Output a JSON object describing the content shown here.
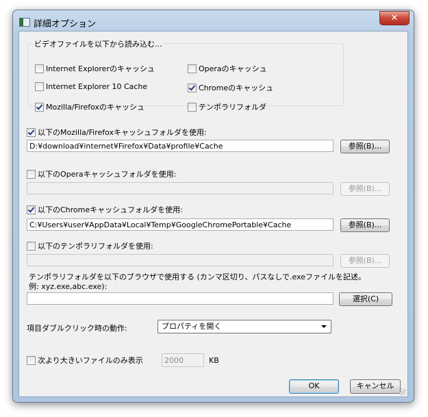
{
  "window": {
    "title": "詳細オプション",
    "close_label": "✕"
  },
  "video_group": {
    "legend": "ビデオファイルを以下から読み込む...",
    "options": [
      {
        "label": "Internet Explorerのキャッシュ",
        "checked": false
      },
      {
        "label": "Operaのキャッシュ",
        "checked": false
      },
      {
        "label": "Internet Explorer 10 Cache",
        "checked": false
      },
      {
        "label": "Chromeのキャッシュ",
        "checked": true
      },
      {
        "label": "Mozilla/Firefoxのキャッシュ",
        "checked": true
      },
      {
        "label": "テンポラリフォルダ",
        "checked": false
      }
    ]
  },
  "folders": {
    "firefox": {
      "label": "以下のMozilla/Firefoxキャッシュフォルダを使用:",
      "checked": true,
      "value": "D:¥download¥internet¥Firefox¥Data¥profile¥Cache",
      "browse": "参照(B)..."
    },
    "opera": {
      "label": "以下のOperaキャッシュフォルダを使用:",
      "checked": false,
      "value": "",
      "browse": "参照(B)..."
    },
    "chrome": {
      "label": "以下のChromeキャッシュフォルダを使用:",
      "checked": true,
      "value": "C:¥Users¥user¥AppData¥Local¥Temp¥GoogleChromePortable¥Cache",
      "browse": "参照(B)..."
    },
    "temp": {
      "label": "以下のテンポラリフォルダを使用:",
      "checked": false,
      "value": "",
      "browse": "参照(B)..."
    }
  },
  "temp_browsers": {
    "description_line1": "テンポラリフォルダを以下のブラウザで使用する (カンマ区切り、パスなしで.exeファイルを記述。",
    "description_line2": "例: xyz.exe,abc.exe):",
    "value": "",
    "select_button": "選択(C)"
  },
  "double_click": {
    "label": "項目ダブルクリック時の動作:",
    "selected": "プロパティを開く"
  },
  "size_filter": {
    "label": "次より大きいファイルのみ表示",
    "checked": false,
    "value": "2000",
    "unit": "KB"
  },
  "buttons": {
    "ok": "OK",
    "cancel": "キャンセル"
  }
}
